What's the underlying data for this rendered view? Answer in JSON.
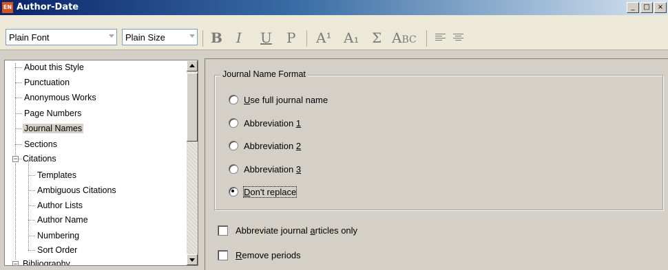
{
  "window": {
    "app_icon": "EN",
    "title": "Author-Date",
    "buttons": [
      "minimize",
      "maximize",
      "close"
    ]
  },
  "toolbar": {
    "font_combo": "Plain Font",
    "size_combo": "Plain Size",
    "format_buttons": [
      "B",
      "I",
      "U",
      "P"
    ],
    "script_buttons": [
      "A¹",
      "A₁",
      "Σ",
      "Abc"
    ],
    "align_buttons": [
      "align-left-icon",
      "align-center-icon"
    ]
  },
  "tree": {
    "items": [
      {
        "label": "About this Style"
      },
      {
        "label": "Punctuation"
      },
      {
        "label": "Anonymous Works"
      },
      {
        "label": "Page Numbers"
      },
      {
        "label": "Journal Names",
        "selected": true
      },
      {
        "label": "Sections"
      },
      {
        "label": "Citations",
        "expanded": true
      },
      {
        "label": "Templates"
      },
      {
        "label": "Ambiguous Citations"
      },
      {
        "label": "Author Lists"
      },
      {
        "label": "Author Name"
      },
      {
        "label": "Numbering"
      },
      {
        "label": "Sort Order"
      },
      {
        "label": "Bibliography",
        "expanded": true
      }
    ]
  },
  "journal_format": {
    "group_title": "Journal Name Format",
    "options": [
      {
        "pre": "",
        "acc": "U",
        "post": "se full journal name",
        "selected": false
      },
      {
        "pre": "Abbreviation ",
        "acc": "1",
        "post": "",
        "selected": false
      },
      {
        "pre": "Abbreviation ",
        "acc": "2",
        "post": "",
        "selected": false
      },
      {
        "pre": "Abbreviation ",
        "acc": "3",
        "post": "",
        "selected": false
      },
      {
        "pre": "",
        "acc": "D",
        "post": "on't replace",
        "selected": true
      }
    ]
  },
  "checkboxes": [
    {
      "pre": "Abbreviate journal ",
      "acc": "a",
      "post": "rticles only",
      "checked": false
    },
    {
      "pre": "",
      "acc": "R",
      "post": "emove periods",
      "checked": false
    }
  ]
}
